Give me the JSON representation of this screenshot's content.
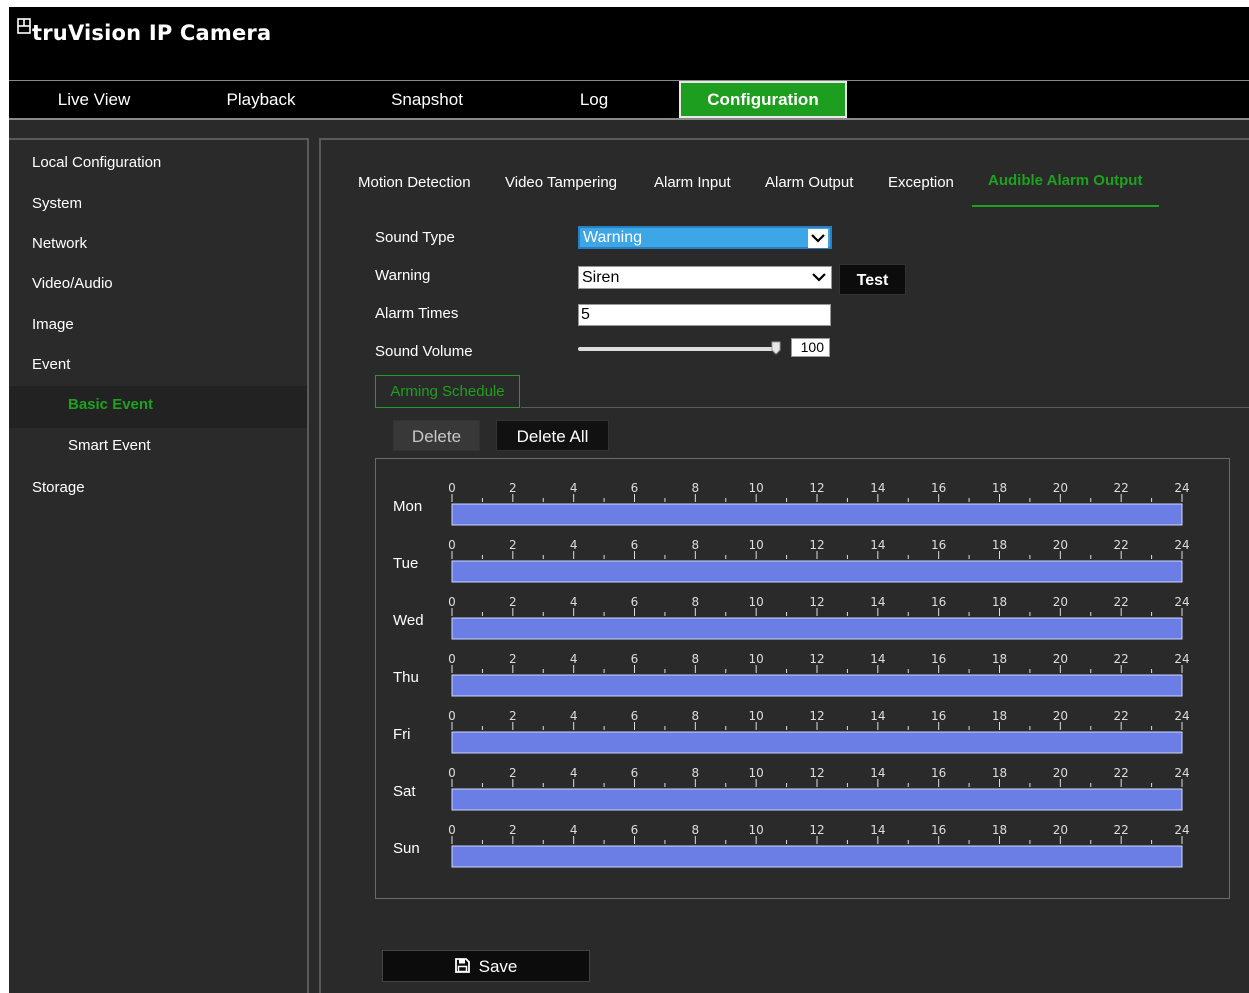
{
  "app": {
    "title": "truVision  IP Camera"
  },
  "nav": {
    "tabs": [
      {
        "label": "Live View"
      },
      {
        "label": "Playback"
      },
      {
        "label": "Snapshot"
      },
      {
        "label": "Log"
      },
      {
        "label": "Configuration",
        "active": true
      }
    ]
  },
  "sidebar": {
    "items": [
      {
        "label": "Local Configuration"
      },
      {
        "label": "System"
      },
      {
        "label": "Network"
      },
      {
        "label": "Video/Audio"
      },
      {
        "label": "Image"
      },
      {
        "label": "Event"
      }
    ],
    "event_sub": [
      {
        "label": "Basic Event",
        "active": true
      },
      {
        "label": "Smart Event"
      }
    ],
    "storage": "Storage"
  },
  "subtabs": [
    {
      "label": "Motion Detection"
    },
    {
      "label": "Video Tampering"
    },
    {
      "label": "Alarm Input"
    },
    {
      "label": "Alarm Output"
    },
    {
      "label": "Exception"
    },
    {
      "label": "Audible Alarm Output",
      "active": true
    }
  ],
  "form": {
    "sound_type_label": "Sound Type",
    "sound_type_value": "Warning",
    "warning_label": "Warning",
    "warning_value": "Siren",
    "test_button": "Test",
    "alarm_times_label": "Alarm Times",
    "alarm_times_value": "5",
    "sound_volume_label": "Sound Volume",
    "sound_volume_value": "100"
  },
  "schedule": {
    "tab_label": "Arming Schedule",
    "delete_button": "Delete",
    "delete_all_button": "Delete All",
    "days": [
      "Mon",
      "Tue",
      "Wed",
      "Thu",
      "Fri",
      "Sat",
      "Sun"
    ],
    "hour_ticks": [
      "0",
      "2",
      "4",
      "6",
      "8",
      "10",
      "12",
      "14",
      "16",
      "18",
      "20",
      "22",
      "24"
    ],
    "ranges": [
      {
        "day": "Mon",
        "start": 0,
        "end": 24
      },
      {
        "day": "Tue",
        "start": 0,
        "end": 24
      },
      {
        "day": "Wed",
        "start": 0,
        "end": 24
      },
      {
        "day": "Thu",
        "start": 0,
        "end": 24
      },
      {
        "day": "Fri",
        "start": 0,
        "end": 24
      },
      {
        "day": "Sat",
        "start": 0,
        "end": 24
      },
      {
        "day": "Sun",
        "start": 0,
        "end": 24
      }
    ]
  },
  "save_button": "Save",
  "colors": {
    "accent_green": "#1ea11e",
    "schedule_bar": "#6b7ee6",
    "highlight_blue": "#3da6e6",
    "background": "#2a2a2a"
  }
}
